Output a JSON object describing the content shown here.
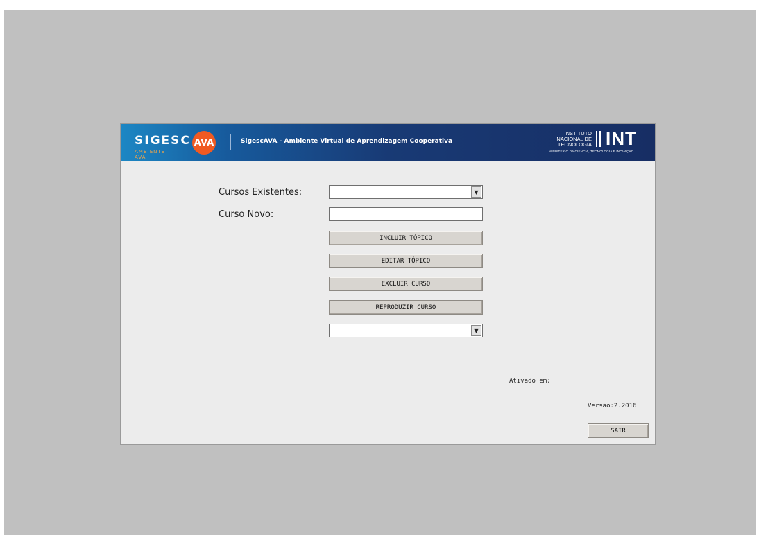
{
  "banner": {
    "logo_main": "SIGESC",
    "logo_badge": "AVA",
    "logo_tagline": "AMBIENTE AVA",
    "title": "SigescAVA - Ambiente Virtual de Aprendizagem Cooperativa",
    "institute_lines": [
      "INSTITUTO",
      "NACIONAL DE",
      "TECNOLOGIA"
    ],
    "institute_acronym": "INT",
    "institute_sub": "MINISTÉRIO DA CIÊNCIA, TECNOLOGIA E INOVAÇÃO",
    "colors": {
      "gradient_start": "#1c87c4",
      "gradient_end": "#172e64",
      "badge": "#f05a22"
    }
  },
  "form": {
    "cursos_existentes_label": "Cursos Existentes:",
    "cursos_existentes_value": "",
    "curso_novo_label": "Curso Novo:",
    "curso_novo_value": "",
    "buttons": {
      "incluir": "INCLUIR TÓPICO",
      "editar": "EDITAR TÓPICO",
      "excluir": "EXCLUIR CURSO",
      "reproduzir": "REPRODUZIR CURSO"
    },
    "second_select_value": ""
  },
  "footer": {
    "ativado_label": "Ativado em:",
    "versao": "Versão:2.2016",
    "sair": "SAIR"
  },
  "icons": {
    "dropdown": "chevron-down-icon"
  }
}
